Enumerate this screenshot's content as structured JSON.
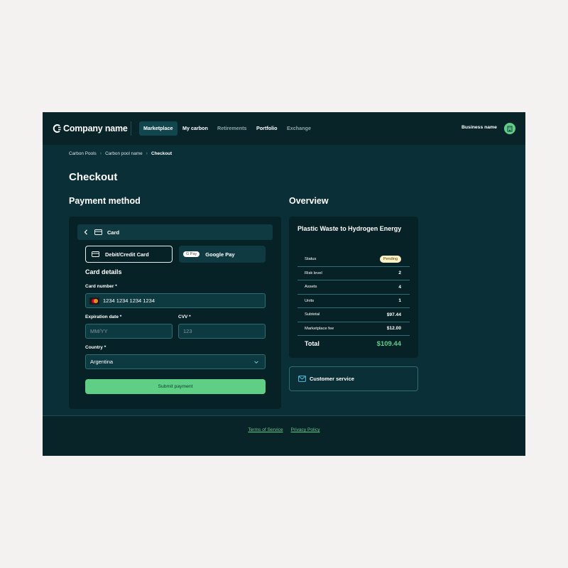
{
  "nav": {
    "logo_text": "Company name",
    "links": [
      "Marketplace",
      "My carbon",
      "Retirements",
      "Portfolio",
      "Exchange"
    ],
    "business_name": "Business name",
    "avatar_icon": "building-icon"
  },
  "breadcrumb": [
    "Carbon Pools",
    "Carbon pool name",
    "Checkout"
  ],
  "page_title": "Checkout",
  "payment": {
    "title": "Payment method",
    "header_label": "Card",
    "tab_debit": "Debit/Credit Card",
    "tab_gpay_badge": "G Pay",
    "tab_gpay": "Google Pay",
    "card_details_title": "Card details",
    "card_number_label": "Card number *",
    "card_number_value": "1234 1234 1234 1234",
    "expiration_label": "Expiration date *",
    "expiration_placeholder": "MM/YY",
    "cvv_label": "CVV *",
    "cvv_placeholder": "123",
    "country_label": "Country *",
    "country_value": "Argentina",
    "submit_label": "Submit payment"
  },
  "overview": {
    "title": "Overview",
    "project_name": "Plastic Waste to Hydrogen Energy",
    "rows": [
      {
        "label": "Status",
        "value": "Pending"
      },
      {
        "label": "Risk level",
        "value": "2"
      },
      {
        "label": "Assets",
        "value": "4"
      },
      {
        "label": "Units",
        "value": "1"
      },
      {
        "label": "Subtotal",
        "value": "$97.44"
      },
      {
        "label": "Marketplace fee",
        "value": "$12.00"
      }
    ],
    "total_label": "Total",
    "total_value": "$109.44",
    "customer_service": "Customer service"
  },
  "footer": {
    "terms": "Terms of Service",
    "privacy": "Privacy Policy"
  },
  "colors": {
    "background": "#0b2f36",
    "nav": "#082429",
    "accent_green": "#5fcf86",
    "border_teal": "#2f6c73"
  }
}
